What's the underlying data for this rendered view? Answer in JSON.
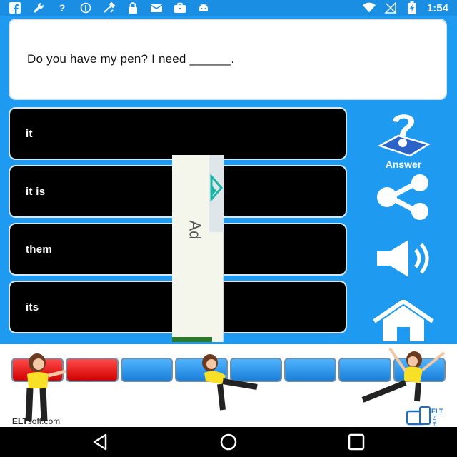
{
  "status_bar": {
    "time": "1:54",
    "icons": [
      "facebook-icon",
      "wrench-icon",
      "help-icon",
      "blocked-icon",
      "tools-icon",
      "lock-icon",
      "mail-icon",
      "briefcase-icon",
      "android-icon",
      "wifi-icon",
      "no-signal-icon",
      "battery-charging-icon"
    ]
  },
  "question": {
    "text": "Do you have my pen? I need ______."
  },
  "options": [
    {
      "label": "it"
    },
    {
      "label": "it is"
    },
    {
      "label": "them"
    },
    {
      "label": "its"
    }
  ],
  "side_controls": {
    "answer_label": "Answer",
    "icons": [
      "question-icon",
      "share-icon",
      "speaker-icon",
      "home-icon"
    ]
  },
  "ad": {
    "label": "Ad"
  },
  "progress": {
    "total": 8,
    "completed": 2,
    "colors": {
      "done": "#e00000",
      "todo": "#1a8ee3"
    }
  },
  "banner": {
    "brand_bold": "ELT",
    "brand_rest": "soft.com",
    "logo_text": "ELT SOFT"
  },
  "colors": {
    "background": "#1e9bf0",
    "option_bg": "#000000",
    "accent": "#1a8ee3"
  }
}
